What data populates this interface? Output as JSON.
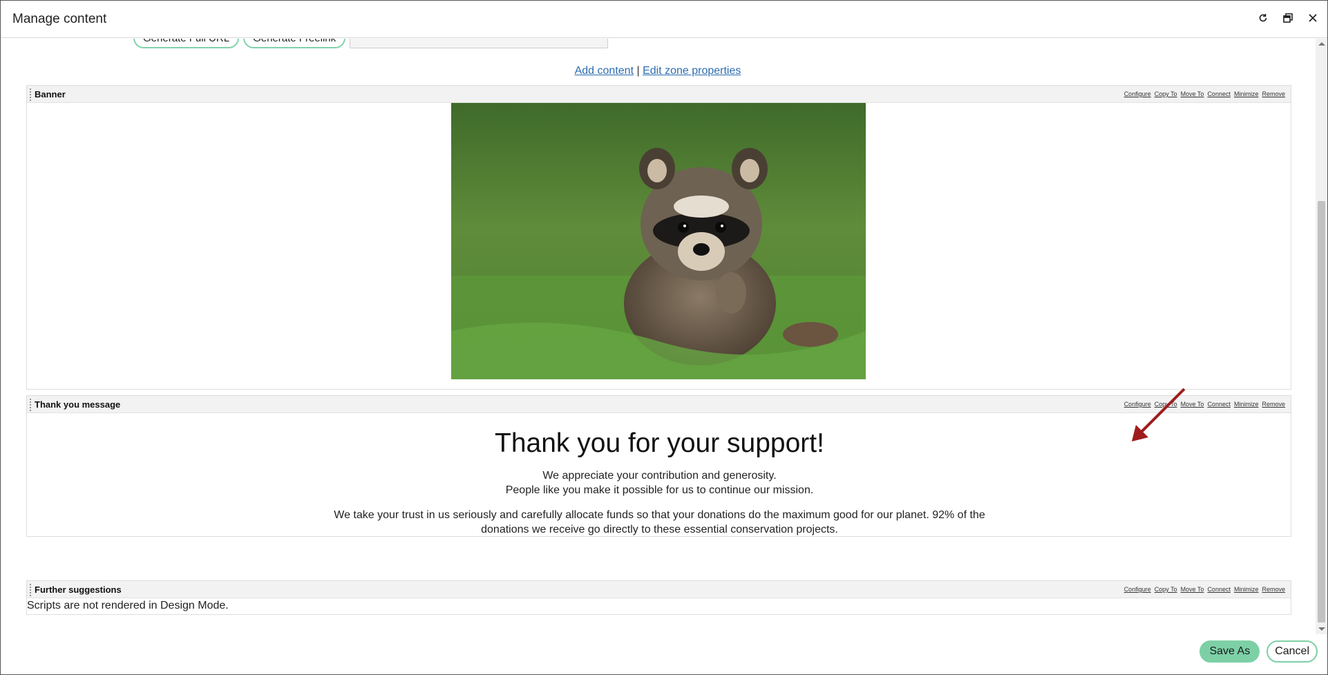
{
  "window": {
    "title": "Manage content"
  },
  "toolbar": {
    "generate_full_url": "Generate Full URL",
    "generate_freelink": "Generate Freelink",
    "url_value": ""
  },
  "zone": {
    "add_content": "Add content",
    "separator": "|",
    "edit_zone": "Edit zone properties"
  },
  "webpart_actions": [
    "Configure",
    "Copy To",
    "Move To",
    "Connect",
    "Minimize",
    "Remove"
  ],
  "webparts": {
    "banner": {
      "title": "Banner"
    },
    "thanks": {
      "title": "Thank you message",
      "heading": "Thank you for your support!",
      "line1": "We appreciate your contribution and generosity.",
      "line2": "People like you make it possible for us to continue our mission.",
      "line3": "We take your trust in us seriously and carefully allocate funds so that your donations do the maximum good for our planet. 92% of the",
      "line4": "donations we receive go directly to these essential conservation projects."
    },
    "suggestions": {
      "title": "Further suggestions",
      "message": "Scripts are not rendered in Design Mode."
    }
  },
  "footer": {
    "save_as": "Save As",
    "cancel": "Cancel"
  },
  "colors": {
    "accent": "#7dd0a6",
    "link": "#2b6cb0",
    "arrow": "#a01c1c"
  },
  "icons": [
    "refresh-icon",
    "maximize-icon",
    "close-icon",
    "grip-icon"
  ]
}
